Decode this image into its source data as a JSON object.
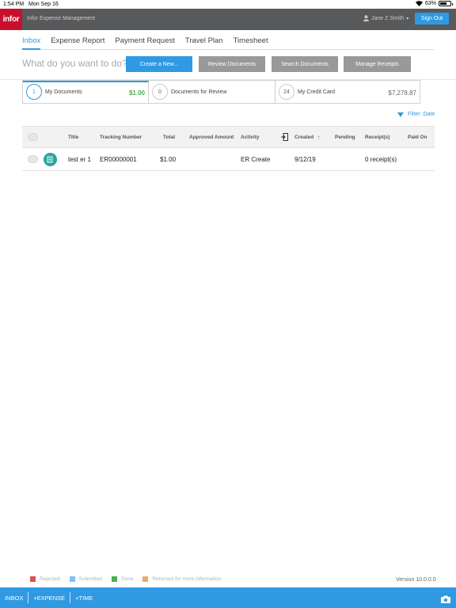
{
  "status_bar": {
    "time": "1:54 PM",
    "date": "Mon Sep 16",
    "battery": "63%",
    "battery_level": 0.63
  },
  "header": {
    "logo": "infor",
    "app_title": "Infor Expense Management",
    "user": "Jane Z Smith",
    "sign_out": "Sign Out"
  },
  "nav": {
    "tabs": [
      {
        "label": "Inbox",
        "active": true
      },
      {
        "label": "Expense Report"
      },
      {
        "label": "Payment Request"
      },
      {
        "label": "Travel Plan"
      },
      {
        "label": "Timesheet"
      }
    ]
  },
  "actions": {
    "prompt": "What do you want to do?",
    "create": "Create a New...",
    "review": "Review Documents",
    "search": "Search Documents",
    "receipts": "Manage Receipts"
  },
  "cards": [
    {
      "count": "1",
      "label": "My Documents",
      "amount": "$1.00",
      "active": true
    },
    {
      "count": "0",
      "label": "Documents for Review",
      "amount": ""
    },
    {
      "count": "24",
      "label": "My Credit Card",
      "amount": "$7,278.87"
    }
  ],
  "filter": {
    "label": "Filter: Date"
  },
  "table": {
    "headers": {
      "title": "Title",
      "tracking": "Tracking Number",
      "total": "Total",
      "approved": "Approved Amount",
      "activity": "Activity",
      "created": "Created",
      "pending": "Pending",
      "receipts": "Receipt(s)",
      "paid": "Paid On"
    },
    "rows": [
      {
        "title": "test er 1",
        "tracking": "ER00000001",
        "total": "$1.00",
        "approved": "",
        "activity": "ER Create",
        "created": "9/12/19",
        "pending": "",
        "receipts": "0 receipt(s)",
        "paid": ""
      }
    ]
  },
  "legend": [
    {
      "label": "Rejected",
      "color": "#d9534f"
    },
    {
      "label": "Submitted",
      "color": "#7fc3ee"
    },
    {
      "label": "Done",
      "color": "#4caf50"
    },
    {
      "label": "Returned for more information",
      "color": "#f0a868"
    }
  ],
  "version": "Version 10.0.0.0",
  "bottom_bar": {
    "inbox": "INBOX",
    "expense": "+EXPENSE",
    "time": "+TIME"
  },
  "colors": {
    "accent": "#2f9ae3",
    "brand": "#c8102e",
    "header_bg": "#58595b",
    "amount_positive": "#4caf50"
  }
}
